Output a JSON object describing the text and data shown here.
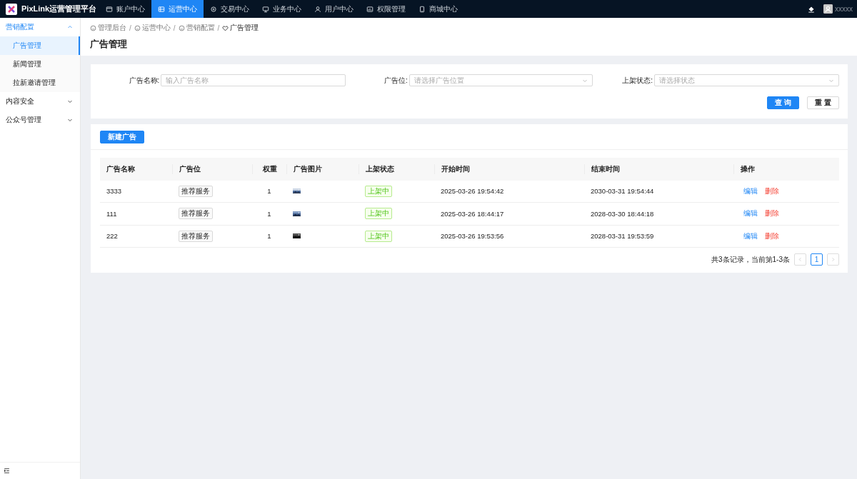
{
  "app": {
    "title": "PixLink运营管理平台",
    "user": "xxxxx"
  },
  "top_nav": [
    {
      "label": "账户中心",
      "selected": false
    },
    {
      "label": "运营中心",
      "selected": true
    },
    {
      "label": "交易中心",
      "selected": false
    },
    {
      "label": "业务中心",
      "selected": false
    },
    {
      "label": "用户中心",
      "selected": false
    },
    {
      "label": "权限管理",
      "selected": false
    },
    {
      "label": "商城中心",
      "selected": false
    }
  ],
  "sidebar": {
    "items": [
      {
        "label": "营销配置",
        "expanded": true,
        "children": [
          {
            "label": "广告管理",
            "selected": true
          },
          {
            "label": "新闻管理",
            "selected": false
          },
          {
            "label": "拉新邀请管理",
            "selected": false
          }
        ]
      },
      {
        "label": "内容安全",
        "expanded": false
      },
      {
        "label": "公众号管理",
        "expanded": false
      }
    ]
  },
  "breadcrumb": {
    "items": [
      "管理后台",
      "运营中心",
      "营销配置",
      "广告管理"
    ],
    "separators": [
      "/",
      "/",
      "/"
    ]
  },
  "page_title": "广告管理",
  "filters": [
    {
      "kind": "input",
      "label": "广告名称:",
      "placeholder": "输入广告名称"
    },
    {
      "kind": "select",
      "label": "广告位:",
      "placeholder": "请选择广告位置"
    },
    {
      "kind": "select",
      "label": "上架状态:",
      "placeholder": "请选择状态"
    }
  ],
  "filter_buttons": [
    {
      "label": "查 询",
      "kind": "primary"
    },
    {
      "label": "重 置",
      "kind": "default"
    }
  ],
  "new_button": "新建广告",
  "table": {
    "columns": [
      "广告名称",
      "广告位",
      "权重",
      "广告图片",
      "上架状态",
      "开始时间",
      "结束时间",
      "操作"
    ],
    "rows": [
      {
        "name": "3333",
        "position": "推荐服务",
        "weight": "1",
        "image": {
          "kind": "picture"
        },
        "status": "上架中",
        "start": "2025-03-26 19:54:42",
        "end": "2030-03-31 19:54:44",
        "actions": [
          "编辑",
          "删除"
        ]
      },
      {
        "name": "111",
        "position": "推荐服务",
        "weight": "1",
        "image": {
          "kind": "picture"
        },
        "status": "上架中",
        "start": "2025-03-26 18:44:17",
        "end": "2028-03-30 18:44:18",
        "actions": [
          "编辑",
          "删除"
        ]
      },
      {
        "name": "222",
        "position": "推荐服务",
        "weight": "1",
        "image": {
          "kind": "picture"
        },
        "status": "上架中",
        "start": "2025-03-26 19:53:56",
        "end": "2028-03-31 19:53:59",
        "actions": [
          "编辑",
          "删除"
        ]
      }
    ]
  },
  "pagination": {
    "summary": "共3条记录，当前第1-3条",
    "pages": [
      {
        "label": "1",
        "selected": true
      }
    ]
  }
}
